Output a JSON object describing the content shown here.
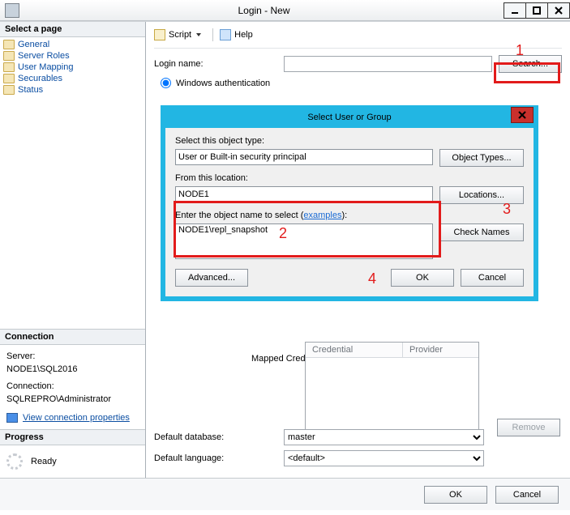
{
  "window": {
    "title": "Login - New"
  },
  "sidebar": {
    "header": "Select a page",
    "items": [
      {
        "label": "General"
      },
      {
        "label": "Server Roles"
      },
      {
        "label": "User Mapping"
      },
      {
        "label": "Securables"
      },
      {
        "label": "Status"
      }
    ]
  },
  "connection": {
    "header": "Connection",
    "server_label": "Server:",
    "server_value": "NODE1\\SQL2016",
    "conn_label": "Connection:",
    "conn_value": "SQLREPRO\\Administrator",
    "link": "View connection properties"
  },
  "progress": {
    "header": "Progress",
    "status": "Ready"
  },
  "toolbar": {
    "script": "Script",
    "help": "Help"
  },
  "form": {
    "login_label": "Login name:",
    "login_value": "",
    "search_btn": "Search...",
    "auth_label": "Windows authentication",
    "mapped_label": "Mapped Credentials",
    "col_cred": "Credential",
    "col_prov": "Provider",
    "remove_btn": "Remove",
    "defdb_label": "Default database:",
    "defdb_value": "master",
    "deflang_label": "Default language:",
    "deflang_value": "<default>"
  },
  "footer": {
    "ok": "OK",
    "cancel": "Cancel"
  },
  "dialog": {
    "title": "Select User or Group",
    "objtype_label": "Select this object type:",
    "objtype_value": "User or Built-in security principal",
    "objtype_btn": "Object Types...",
    "loc_label": "From this location:",
    "loc_value": "NODE1",
    "loc_btn": "Locations...",
    "names_label_a": "Enter the object name to select (",
    "names_label_link": "examples",
    "names_label_b": "):",
    "names_value": "NODE1\\repl_snapshot",
    "check_btn": "Check Names",
    "advanced_btn": "Advanced...",
    "ok": "OK",
    "cancel": "Cancel"
  },
  "annotations": {
    "n1": "1",
    "n2": "2",
    "n3": "3",
    "n4": "4"
  }
}
